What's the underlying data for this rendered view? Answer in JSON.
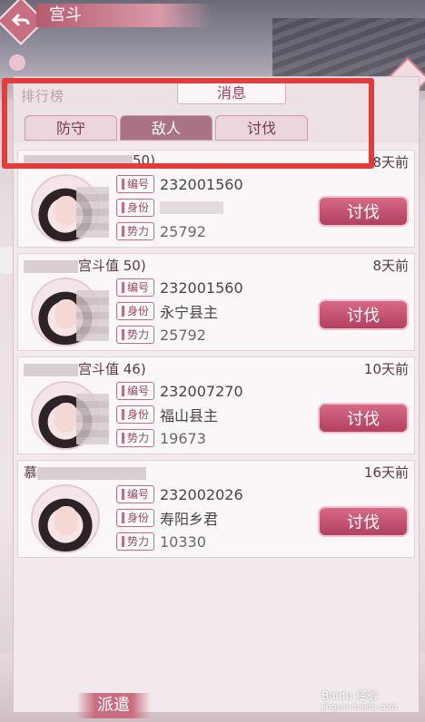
{
  "header": {
    "title": "宫斗"
  },
  "panel": {
    "rank_label": "排行榜",
    "message_title": "消息",
    "tabs": [
      {
        "label": "防守",
        "active": false
      },
      {
        "label": "敌人",
        "active": true
      },
      {
        "label": "讨伐",
        "active": false
      }
    ]
  },
  "labels": {
    "id": "编号",
    "rank": "身份",
    "power": "势力",
    "attack": "讨伐"
  },
  "enemies": [
    {
      "name_suffix": "50)",
      "time": "8天前",
      "id": "232001560",
      "rank": "",
      "power": "25792"
    },
    {
      "name_suffix": "宫斗值 50)",
      "time": "8天前",
      "id": "232001560",
      "rank": "永宁县主",
      "power": "25792"
    },
    {
      "name_suffix": "宫斗值 46)",
      "time": "10天前",
      "id": "232007270",
      "rank": "福山县主",
      "power": "19673"
    },
    {
      "name_suffix": "",
      "name_prefix": "慕",
      "time": "16天前",
      "id": "232002026",
      "rank": "寿阳乡君",
      "power": "10330"
    }
  ],
  "footer": {
    "dispatch": "派遣"
  },
  "watermark": {
    "brand": "Baidu 经验",
    "url": "jingyan.baidu.com"
  },
  "colors": {
    "accent": "#b2405f",
    "highlight": "#e23c3c"
  }
}
